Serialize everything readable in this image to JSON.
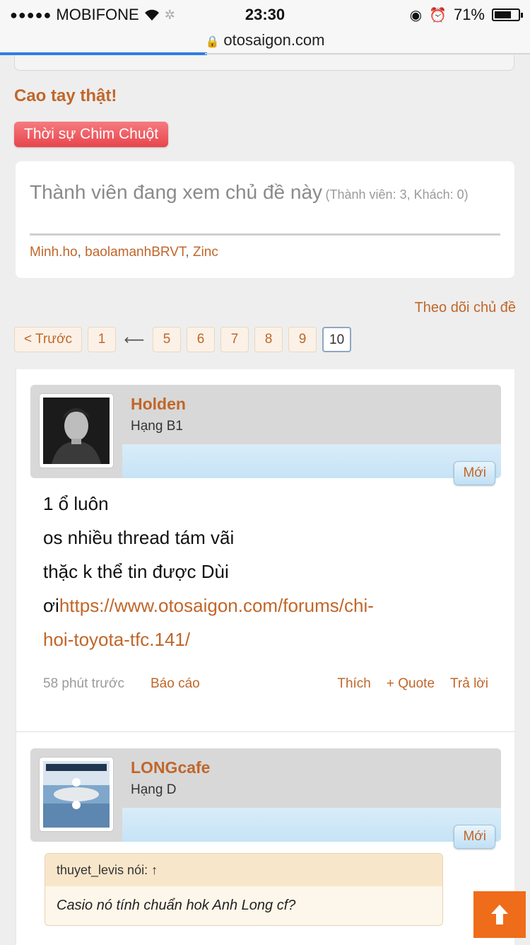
{
  "status_bar": {
    "carrier": "MOBIFONE",
    "signal_dots": "●●●●●",
    "time": "23:30",
    "battery": "71%",
    "battery_level": 0.71
  },
  "browser": {
    "url": "otosaigon.com",
    "load_progress": 0.39
  },
  "thread": {
    "title": "Cao tay thật!",
    "tag": "Thời sự Chim Chuột",
    "follow_label": "Theo dõi chủ đề"
  },
  "viewers": {
    "heading": "Thành viên đang xem chủ đề này",
    "counts": "(Thành viên: 3, Khách: 0)",
    "members": [
      "Minh.ho",
      "baolamanhBRVT",
      "Zinc"
    ],
    "separator": ","
  },
  "pagination": {
    "prev": "< Trước",
    "first": "1",
    "ellipsis": "⟵",
    "pages": [
      "5",
      "6",
      "7",
      "8",
      "9"
    ],
    "current": "10"
  },
  "posts": [
    {
      "username": "Holden",
      "rank": "Hạng B1",
      "badge": "Mới",
      "lines": [
        "1 ổ luôn",
        "os nhiều thread tám vãi",
        "thặc k thể tin được Dùi"
      ],
      "link_prefix": "ơi",
      "link_line1": "https://www.otosaigon.com/forums/chi-",
      "link_line2": "hoi-toyota-tfc.141/",
      "time": "58 phút trước",
      "report": "Báo cáo",
      "like": "Thích",
      "quote_btn": "+ Quote",
      "reply": "Trả lời"
    },
    {
      "username": "LONGcafe",
      "rank": "Hạng D",
      "badge": "Mới",
      "quote_author": "thuyet_levis nói: ↑",
      "quote_text": "Casio nó tính chuẩn hok Anh Long cf?"
    }
  ],
  "scroll_top_icon": "arrow-up-icon",
  "colors": {
    "accent": "#c0662a",
    "tag": "#e8454c",
    "to_top": "#ef6c1a",
    "progress": "#2f7fe0"
  }
}
